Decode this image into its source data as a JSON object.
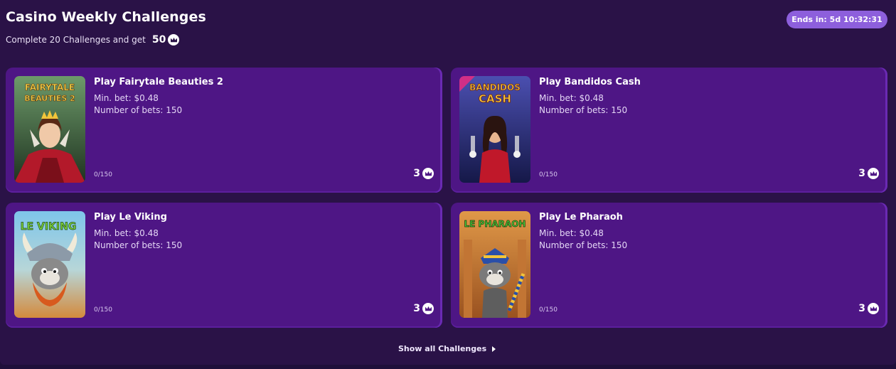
{
  "header": {
    "title": "Casino Weekly Challenges",
    "subtitle": "Complete 20 Challenges and get",
    "total_reward": "50",
    "timer": "Ends in: 5d 10:32:31"
  },
  "challenges": [
    {
      "name": "Play Fairytale Beauties 2",
      "min_bet": "Min. bet: $0.48",
      "bets": "Number of bets: 150",
      "progress": "0/150",
      "reward": "3",
      "thumb_text": [
        "FAIRYTALE",
        "BEAUTIES 2"
      ],
      "thumb_colors": {
        "bg1": "#5a7f5a",
        "bg2": "#2f4a2e",
        "accent": "#c21f2a",
        "logo": "#f7d64a"
      }
    },
    {
      "name": "Play Bandidos Cash",
      "min_bet": "Min. bet: $0.48",
      "bets": "Number of bets: 150",
      "progress": "0/150",
      "reward": "3",
      "thumb_text": [
        "BANDIDOS",
        "CASH"
      ],
      "thumb_colors": {
        "bg1": "#3b3f9a",
        "bg2": "#1a1d5c",
        "accent": "#c0182a",
        "logo": "#f3c43a"
      }
    },
    {
      "name": "Play Le Viking",
      "min_bet": "Min. bet: $0.48",
      "bets": "Number of bets: 150",
      "progress": "0/150",
      "reward": "3",
      "thumb_text": [
        "LE VIKING"
      ],
      "thumb_colors": {
        "bg1": "#88c8e8",
        "bg2": "#d88a3a",
        "accent": "#d85a1e",
        "logo": "#7ed03a"
      }
    },
    {
      "name": "Play Le Pharaoh",
      "min_bet": "Min. bet: $0.48",
      "bets": "Number of bets: 150",
      "progress": "0/150",
      "reward": "3",
      "thumb_text": [
        "LE PHARAOH"
      ],
      "thumb_colors": {
        "bg1": "#d98a38",
        "bg2": "#a85a22",
        "accent": "#2a4fa8",
        "logo": "#4ec63a"
      }
    }
  ],
  "footer": {
    "show_all": "Show all Challenges"
  },
  "icons": {
    "reward_icon": "crown-icon",
    "arrow_icon": "chevron-right-icon"
  }
}
